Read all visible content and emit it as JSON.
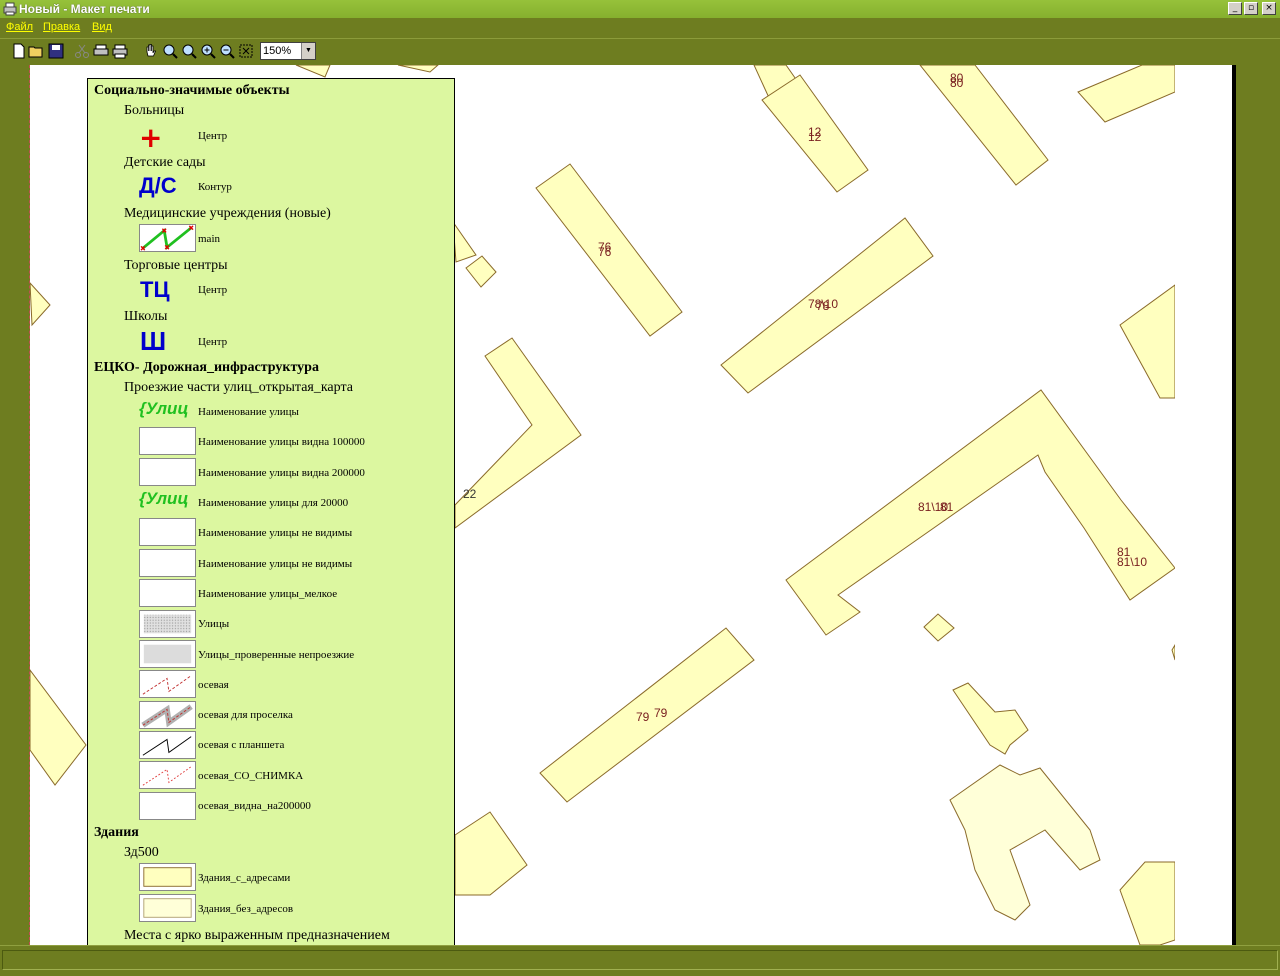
{
  "window": {
    "title": "Новый - Макет печати",
    "controls": [
      "_",
      "▫",
      "×"
    ]
  },
  "menu": {
    "items": [
      "Файл",
      "Правка",
      "Вид"
    ]
  },
  "toolbar": {
    "zoom_value": "150%"
  },
  "legend": {
    "groups": [
      {
        "title": "Социально-значимые объекты",
        "layers": [
          {
            "name": "Больницы",
            "items": [
              {
                "symbol": "+",
                "label": "Центр"
              }
            ]
          },
          {
            "name": "Детские сады",
            "items": [
              {
                "symbol": "Д/С",
                "label": "Контур"
              }
            ]
          },
          {
            "name": "Медицинские учреждения (новые)",
            "items": [
              {
                "symbol": "",
                "label": "main"
              }
            ]
          },
          {
            "name": "Торговые центры",
            "items": [
              {
                "symbol": "ТЦ",
                "label": "Центр"
              }
            ]
          },
          {
            "name": "Школы",
            "items": [
              {
                "symbol": "Ш",
                "label": "Центр"
              }
            ]
          }
        ]
      },
      {
        "title": "ЕЦКО- Дорожная_инфраструктура",
        "layers": [
          {
            "name": "Проезжие части улиц_открытая_карта",
            "items": [
              {
                "symbol": "{Улиц",
                "label": "Наименование улицы"
              },
              {
                "symbol": "",
                "label": "Наименование улицы видна 100000"
              },
              {
                "symbol": "",
                "label": "Наименование улицы видна 200000"
              },
              {
                "symbol": "{Улиц",
                "label": "Наименование улицы для 20000"
              },
              {
                "symbol": "",
                "label": "Наименование улицы не видимы"
              },
              {
                "symbol": "",
                "label": "Наименование улицы не видимы"
              },
              {
                "symbol": "",
                "label": "Наименование улицы_мелкое"
              },
              {
                "symbol": "",
                "label": "Улицы"
              },
              {
                "symbol": "",
                "label": "Улицы_проверенные непроезжие"
              },
              {
                "symbol": "",
                "label": "осевая"
              },
              {
                "symbol": "",
                "label": "осевая для проселка"
              },
              {
                "symbol": "",
                "label": "осевая с планшета"
              },
              {
                "symbol": "",
                "label": "осевая_СО_СНИМКА"
              },
              {
                "symbol": "",
                "label": "осевая_видна_на200000"
              }
            ]
          }
        ]
      },
      {
        "title": "Здания",
        "layers": [
          {
            "name": "Зд500",
            "items": [
              {
                "symbol": "",
                "label": "Здания_с_адресами"
              },
              {
                "symbol": "",
                "label": "Здания_без_адресов"
              }
            ]
          },
          {
            "name": "Места с ярко выраженным предназначением",
            "items": []
          }
        ]
      }
    ]
  },
  "map_labels": [
    "80",
    "80",
    "12",
    "12",
    "76",
    "76",
    "78\\10",
    "78",
    "22",
    "81\\10",
    "81",
    "81",
    "81\\10",
    "79",
    "79"
  ],
  "colors": {
    "building_fill": "#ffffbf",
    "building_stroke": "#8a6a2a",
    "chrome": "#6e7d20",
    "legend_bg": "#dcf7a0"
  }
}
